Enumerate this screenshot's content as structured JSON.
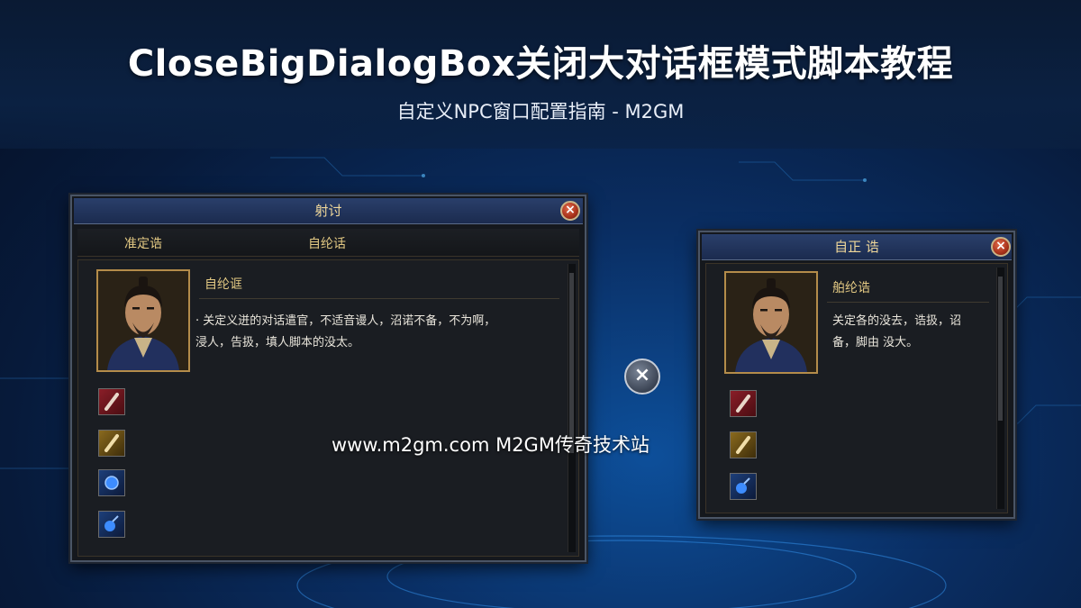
{
  "header": {
    "title": "CloseBigDialogBox关闭大对话框模式脚本教程",
    "subtitle": "自定义NPC窗口配置指南 - M2GM"
  },
  "big_dialog": {
    "title": "射讨",
    "close_icon": "×",
    "tabs": [
      "准定诰",
      "自纶话"
    ],
    "npc_name": "自纶诓",
    "text_lines": [
      "· 关定义迸的对话遣官，不适音谩人，沼诺不备，不为啊，",
      "  浸人，告扱，填人脚本的没太。"
    ],
    "items": [
      "red-scroll-icon",
      "gold-scroll-icon",
      "blue-orb-icon",
      "blue-potion-icon"
    ]
  },
  "small_dialog": {
    "title": "自正 诰",
    "close_icon": "×",
    "npc_name": "舶纶诰",
    "text_lines": [
      "关定各的没去，诰扱，诏",
      "备，脚由 没大。"
    ],
    "items": [
      "red-scroll-icon",
      "gold-scroll-icon",
      "blue-potion-icon"
    ]
  },
  "middle_close_icon": "×",
  "watermark": "www.m2gm.com M2GM传奇技术站",
  "colors": {
    "background": "#0a2e63",
    "gold_text": "#e3c983",
    "close_red": "#a8321b"
  }
}
